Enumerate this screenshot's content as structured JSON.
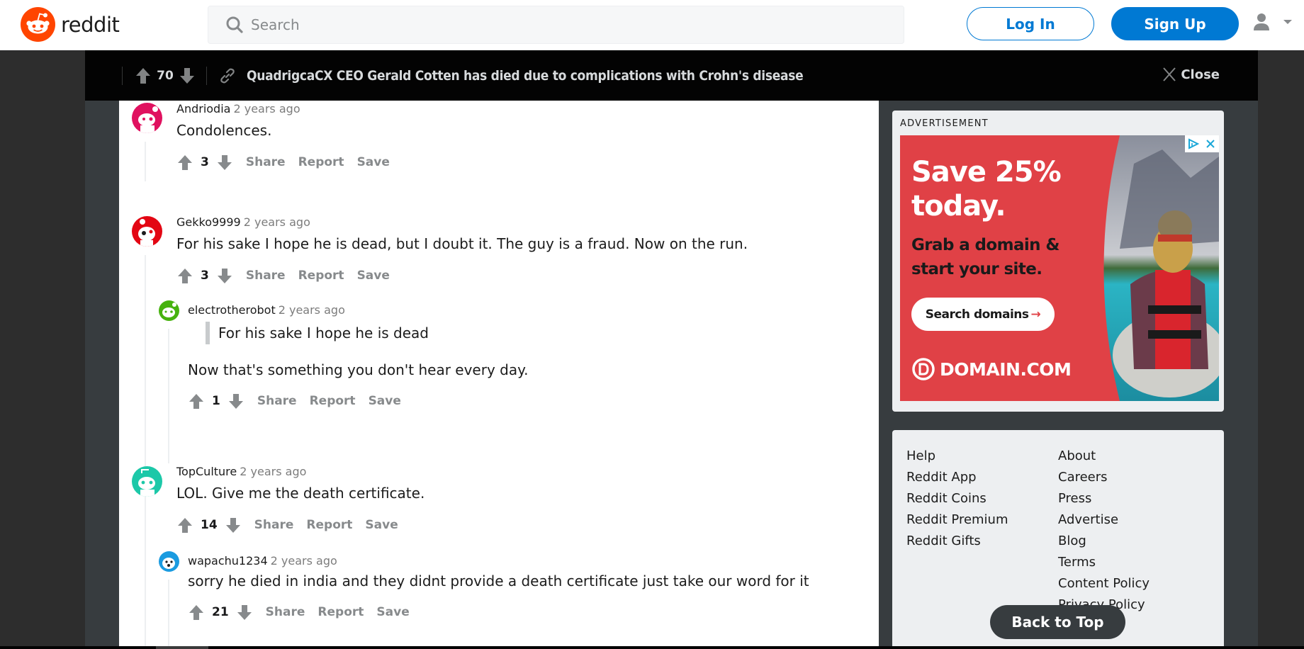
{
  "header": {
    "logo_text": "reddit",
    "search_placeholder": "Search",
    "login_label": "Log In",
    "signup_label": "Sign Up",
    "icons": {
      "logo": "reddit-snoo-icon",
      "search": "search-icon",
      "user": "user-icon",
      "caret": "caret-down-icon"
    }
  },
  "post_bar": {
    "score": "70",
    "title": "QuadrigcaCX CEO Gerald Cotten has died due to complications with Crohn's disease",
    "close_label": "Close",
    "icons": {
      "upvote": "upvote-arrow-icon",
      "downvote": "downvote-arrow-icon",
      "link": "link-icon",
      "close": "close-x-icon"
    }
  },
  "comments": [
    {
      "author": "Andriodia",
      "time": "2 years ago",
      "body": "Condolences.",
      "score": "3",
      "avatar_color": "#e0115f",
      "actions": [
        "Share",
        "Report",
        "Save"
      ]
    },
    {
      "author": "Gekko9999",
      "time": "2 years ago",
      "body": "For his sake I hope he is dead, but I doubt it. The guy is a fraud. Now on the run.",
      "score": "3",
      "avatar_color": "#e30613",
      "actions": [
        "Share",
        "Report",
        "Save"
      ]
    },
    {
      "author": "electrotherobot",
      "time": "2 years ago",
      "quote": "For his sake I hope he is dead",
      "body": "Now that's something you don't hear every day.",
      "score": "1",
      "avatar_color": "#46b20e",
      "actions": [
        "Share",
        "Report",
        "Save"
      ]
    },
    {
      "author": "TopCulture",
      "time": "2 years ago",
      "body": "LOL. Give me the death certificate.",
      "score": "14",
      "avatar_color": "#1cc8a8",
      "actions": [
        "Share",
        "Report",
        "Save"
      ]
    },
    {
      "author": "wapachu1234",
      "time": "2 years ago",
      "body": "sorry he died in india and they didnt provide a death certificate just take our word for it",
      "score": "21",
      "avatar_color": "#1a9be0",
      "actions": [
        "Share",
        "Report",
        "Save"
      ]
    }
  ],
  "advertisement": {
    "label": "ADVERTISEMENT",
    "headline_line1": "Save 25%",
    "headline_line2": "today.",
    "sub_line1": "Grab a domain &",
    "sub_line2": "start your site.",
    "cta": "Search domains",
    "cta_arrow": "→",
    "brand": "DOMAIN.COM",
    "bg_color": "#e04146",
    "icons": {
      "adchoices": "adchoices-icon",
      "close": "ad-close-icon",
      "brand": "domain-logo-icon"
    }
  },
  "footer": {
    "left_links": [
      "Help",
      "Reddit App",
      "Reddit Coins",
      "Reddit Premium",
      "Reddit Gifts"
    ],
    "right_links": [
      "About",
      "Careers",
      "Press",
      "Advertise",
      "Blog",
      "Terms",
      "Content Policy",
      "Privacy Policy"
    ],
    "back_to_top": "Back to Top"
  },
  "colors": {
    "brand_orange": "#ff4500",
    "primary_blue": "#0079d3",
    "dark_bar": "#030303",
    "side_gray": "#373c3f"
  }
}
